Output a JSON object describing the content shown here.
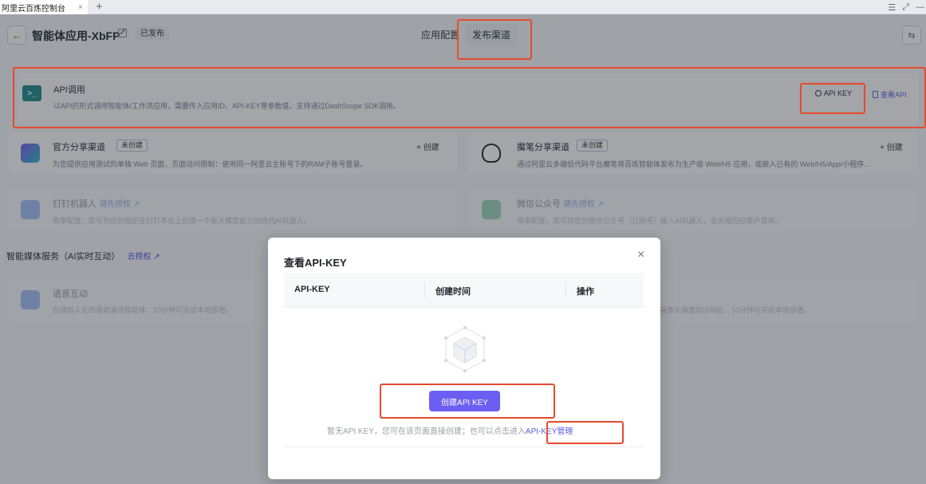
{
  "browser": {
    "tab_title": "阿里云百炼控制台",
    "tab_close": "×",
    "new_tab": "+",
    "controls": [
      "☰",
      "⤢",
      "—"
    ]
  },
  "header": {
    "back": "←",
    "app_title": "智能体应用-XbFP",
    "status_badge": "已发布",
    "tabs": [
      {
        "label": "应用配置"
      },
      {
        "label": "发布渠道"
      }
    ],
    "collapse": "⇆"
  },
  "api_card": {
    "icon": ">_",
    "title": "API调用",
    "description": "以API的形式调用智能体/工作流应用，需要传入应用ID、API-KEY等参数值，支持通过DashScope SDK调用。",
    "api_key_label": "API KEY",
    "view_api_label": "查看API"
  },
  "channels": [
    {
      "title": "官方分享渠道",
      "chip": "未创建",
      "create": "+ 创建",
      "desc": "为您提供应用测试的单独 Web 页面，页面访问限制：使用同一阿里云主账号下的RAM子账号登录。"
    },
    {
      "title": "魔笔分享渠道",
      "chip": "未创建",
      "create": "+ 创建",
      "desc": "通过阿里云多端低代码平台魔笔将百炼智能体发布为生产级 Web/H5 应用，或嵌入已有的 Web/H5/App/小程序..."
    },
    {
      "title": "钉钉机器人",
      "auth": "请先授权 ↗",
      "desc": "简单配置，即可为您的组织在钉钉平台上创建一个有大模型能力加成的AI机器人。"
    },
    {
      "title": "微信公众号",
      "auth": "请先授权 ↗",
      "desc": "简单配置，即可将您的微信公众号（订阅号）接入AI机器人，全天候回应客户咨询。"
    }
  ],
  "media_section": {
    "title": "智能媒体服务（AI实时互动）",
    "auth": "去授权 ↗",
    "voice_title": "语音互动",
    "voice_desc": "创建拟人化的语音通话智能体，10分钟可完成本地部署。",
    "right_desc": "及摄像头画面给出响应，10分钟可完成本地部署。"
  },
  "modal": {
    "title": "查看API-KEY",
    "close": "×",
    "columns": [
      "API-KEY",
      "创建时间",
      "操作"
    ],
    "create_button": "创建API KEY",
    "empty_note": "暂无API KEY，您可在该页面直接创建；也可以点击进入",
    "mgmt_link": "API-KEY管理"
  }
}
